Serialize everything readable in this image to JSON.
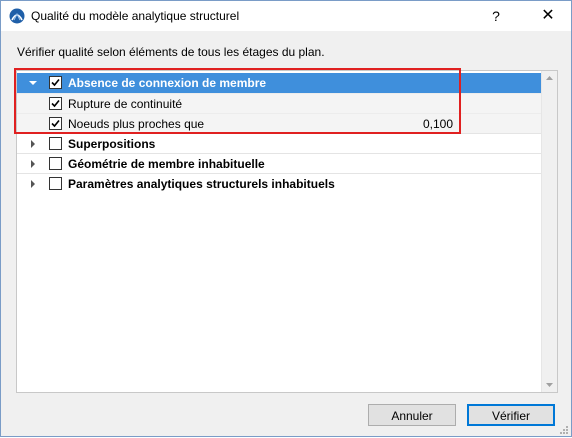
{
  "window": {
    "title": "Qualité du modèle analytique structurel",
    "help_label": "?",
    "close_label": "✕"
  },
  "instruction": "Vérifier qualité selon éléments de tous les étages du plan.",
  "tree": {
    "items": [
      {
        "label": "Absence de connexion de membre",
        "checked": true,
        "expanded": true,
        "selected": true,
        "bold": true,
        "value": ""
      },
      {
        "label": "Rupture de continuité",
        "checked": true,
        "child": true,
        "value": ""
      },
      {
        "label": "Noeuds plus proches que",
        "checked": true,
        "child": true,
        "value": "0,100"
      },
      {
        "label": "Superpositions",
        "checked": false,
        "expanded": false,
        "bold": true,
        "value": ""
      },
      {
        "label": "Géométrie de membre inhabituelle",
        "checked": false,
        "expanded": false,
        "bold": true,
        "value": ""
      },
      {
        "label": "Paramètres analytiques structurels inhabituels",
        "checked": false,
        "expanded": false,
        "bold": true,
        "value": ""
      }
    ]
  },
  "buttons": {
    "cancel": "Annuler",
    "verify": "Vérifier"
  },
  "colors": {
    "selection": "#3f8fdc",
    "highlight_frame": "#e02020",
    "default_button_border": "#0078d7"
  },
  "icons": {
    "app": "archicad-app-icon",
    "expanded": "triangle-down-icon",
    "collapsed": "triangle-right-icon",
    "check": "checkmark-icon"
  }
}
